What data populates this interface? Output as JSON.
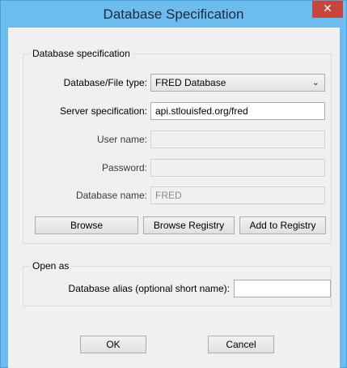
{
  "window": {
    "title": "Database Specification",
    "close_glyph": "✕"
  },
  "db_group": {
    "legend": "Database specification",
    "type_label": "Database/File type:",
    "type_value": "FRED Database",
    "server_label": "Server specification:",
    "server_value": "api.stlouisfed.org/fred",
    "user_label": "User name:",
    "user_value": "",
    "password_label": "Password:",
    "password_value": "",
    "dbname_label": "Database name:",
    "dbname_value": "FRED",
    "browse_label": "Browse",
    "browse_registry_label": "Browse Registry",
    "add_registry_label": "Add to Registry"
  },
  "open_group": {
    "legend": "Open as",
    "alias_label": "Database alias (optional short name):",
    "alias_value": ""
  },
  "footer": {
    "ok_label": "OK",
    "cancel_label": "Cancel"
  },
  "icons": {
    "dropdown": "chevron-down-icon",
    "close": "close-icon"
  }
}
